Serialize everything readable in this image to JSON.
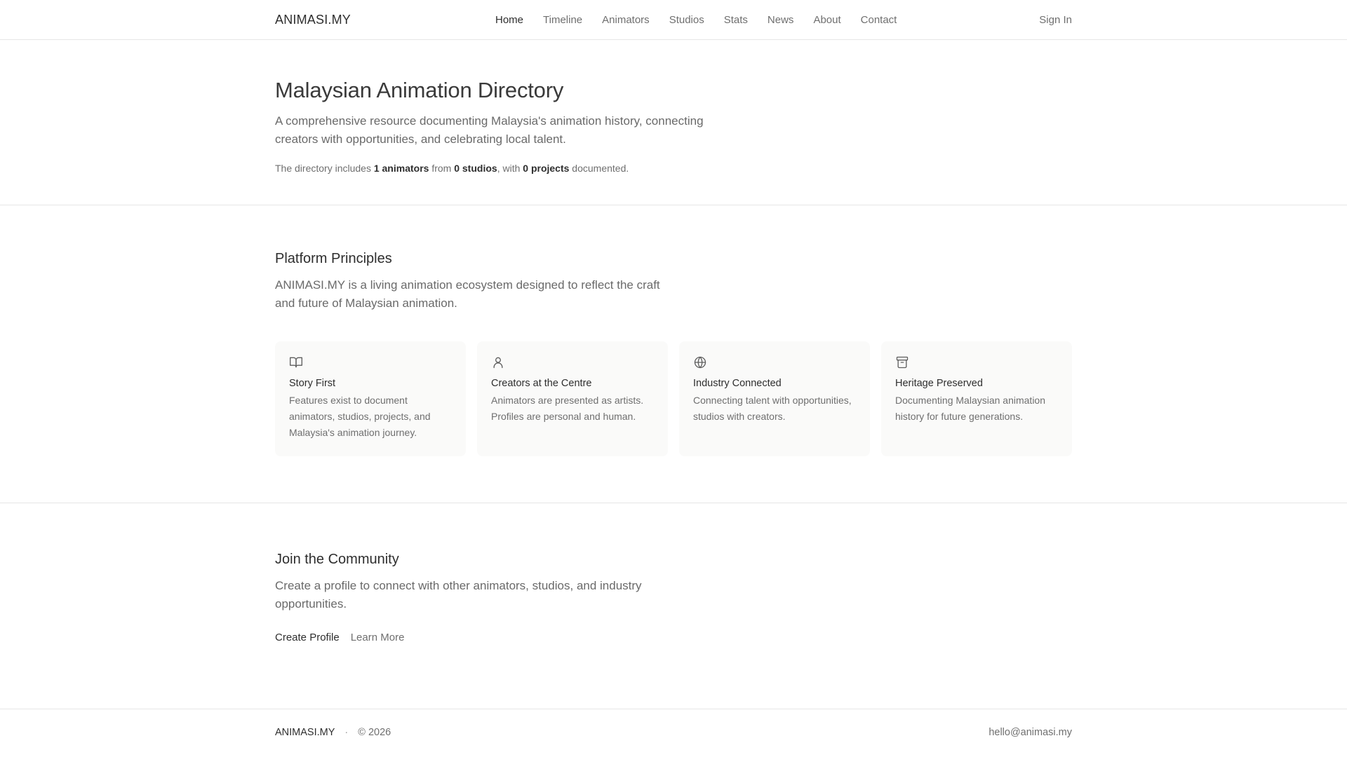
{
  "header": {
    "logo": "ANIMASI.MY",
    "nav": [
      {
        "label": "Home"
      },
      {
        "label": "Timeline"
      },
      {
        "label": "Animators"
      },
      {
        "label": "Studios"
      },
      {
        "label": "Stats"
      },
      {
        "label": "News"
      },
      {
        "label": "About"
      },
      {
        "label": "Contact"
      }
    ],
    "signin": "Sign In"
  },
  "hero": {
    "title": "Malaysian Animation Directory",
    "lead": "A comprehensive resource documenting Malaysia's animation history, connecting creators with opportunities, and celebrating local talent.",
    "stats": {
      "prefix": "The directory includes",
      "animators": "1 animators",
      "from": "from",
      "studios": "0 studios",
      "with": ", with",
      "projects": "0 projects",
      "suffix": "documented."
    }
  },
  "principles": {
    "title": "Platform Principles",
    "lead": "ANIMASI.MY is a living animation ecosystem designed to reflect the craft and future of Malaysian animation.",
    "cards": [
      {
        "icon": "book-open-icon",
        "title": "Story First",
        "text": "Features exist to document animators, studios, projects, and Malaysia's animation journey."
      },
      {
        "icon": "user-icon",
        "title": "Creators at the Centre",
        "text": "Animators are presented as artists. Profiles are personal and human."
      },
      {
        "icon": "globe-icon",
        "title": "Industry Connected",
        "text": "Connecting talent with opportunities, studios with creators."
      },
      {
        "icon": "archive-icon",
        "title": "Heritage Preserved",
        "text": "Documenting Malaysian animation history for future generations."
      }
    ]
  },
  "join": {
    "title": "Join the Community",
    "lead": "Create a profile to connect with other animators, studios, and industry opportunities.",
    "primary": "Create Profile",
    "secondary": "Learn More"
  },
  "footer": {
    "logo": "ANIMASI.MY",
    "dot": "·",
    "copyright": "© 2026",
    "email": "hello@animasi.my"
  }
}
